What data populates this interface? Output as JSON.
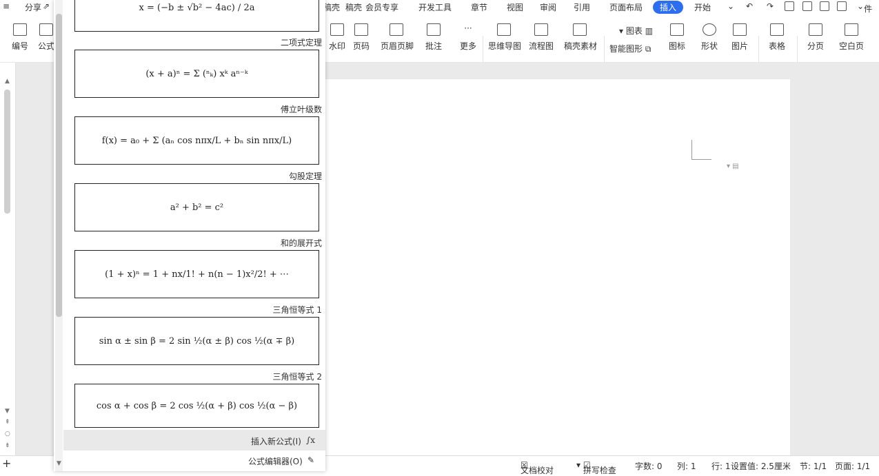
{
  "menu": {
    "share": "分享",
    "tabs": [
      "稿壳",
      "会员专享",
      "开发工具",
      "章节",
      "视图",
      "审阅",
      "引用",
      "页面布局",
      "插入",
      "开始"
    ],
    "active_tab": "插入",
    "accent": "#2d6ef0",
    "right_label": "件"
  },
  "ribbon": {
    "left_buttons": [
      "编号",
      "公式"
    ],
    "buttons": [
      "水印",
      "页码",
      "页眉页脚",
      "批注",
      "更多",
      "思维导图",
      "流程图",
      "稿壳素材",
      "智能图形",
      "图标",
      "形状",
      "图片",
      "表格",
      "分页",
      "空白页"
    ],
    "chart_label": "图表"
  },
  "panel": {
    "formulas": [
      {
        "title": "二项式定理",
        "expr": "(x + a)ⁿ = Σ (ⁿₖ) xᵏ aⁿ⁻ᵏ"
      },
      {
        "title": "傅立叶级数",
        "expr": "f(x) = a₀ + Σ (aₙ cos nπx/L + bₙ sin nπx/L)"
      },
      {
        "title": "勾股定理",
        "expr": "a² + b² = c²"
      },
      {
        "title": "和的展开式",
        "expr": "(1 + x)ⁿ = 1 + nx/1! + n(n − 1)x²/2! + ⋯"
      },
      {
        "title": "三角恒等式 1",
        "expr": "sin α ± sin β = 2 sin ½(α ± β) cos ½(α ∓ β)"
      },
      {
        "title": "三角恒等式 2",
        "expr": "cos α + cos β = 2 cos ½(α + β) cos ½(α − β)"
      }
    ],
    "top_formula": "x = (−b ± √b² − 4ac) / 2a",
    "insert_new": "插入新公式(I)",
    "editor": "公式编辑器(O)"
  },
  "status": {
    "page": "页面: 1/1",
    "section": "节: 1/1",
    "setting": "设置值: 2.5厘米",
    "row": "行: 1",
    "col": "列: 1",
    "words": "字数: 0",
    "spell": "拼写检查",
    "proof": "文档校对"
  }
}
